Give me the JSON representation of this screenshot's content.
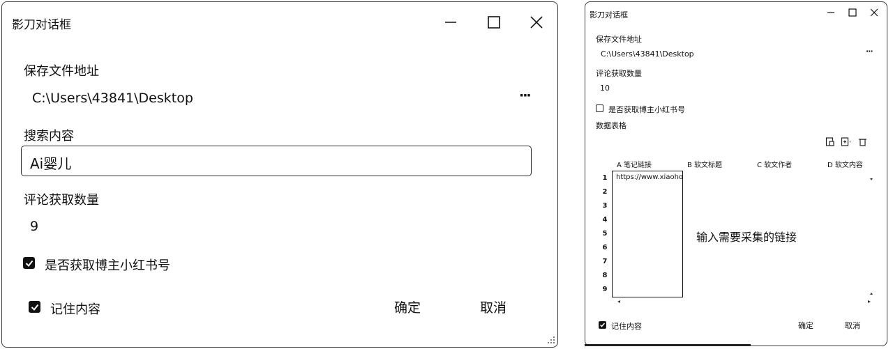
{
  "left_dialog": {
    "title": "影刀对话框",
    "save_path_label": "保存文件地址",
    "save_path_value": "C:\\Users\\43841\\Desktop",
    "browse_button": "···",
    "search_label": "搜索内容",
    "search_value": "Ai婴儿",
    "comment_count_label": "评论获取数量",
    "comment_count_value": "9",
    "get_account_checkbox": {
      "label": "是否获取博主小红书号",
      "checked": true
    },
    "remember_checkbox": {
      "label": "记住内容",
      "checked": true
    },
    "ok_button": "确定",
    "cancel_button": "取消"
  },
  "right_dialog": {
    "title": "影刀对话框",
    "save_path_label": "保存文件地址",
    "save_path_value": "C:\\Users\\43841\\Desktop",
    "browse_button": "···",
    "comment_count_label": "评论获取数量",
    "comment_count_value": "10",
    "get_account_checkbox": {
      "label": "是否获取博主小红书号",
      "checked": false
    },
    "table_label": "数据表格",
    "columns": [
      "A 笔记链接",
      "B 软文标题",
      "C 软文作者",
      "D 软文内容"
    ],
    "row_numbers": [
      "1",
      "2",
      "3",
      "4",
      "5",
      "6",
      "7",
      "8",
      "9"
    ],
    "first_cell": "https://www.xiaohongshu.com",
    "annotation": "输入需要采集的链接",
    "remember_checkbox": {
      "label": "记住内容",
      "checked": true
    },
    "ok_button": "确定",
    "cancel_button": "取消"
  },
  "icons": [
    "minimize-icon",
    "maximize-icon",
    "close-icon",
    "checkbox-checked-icon",
    "resize-grip-icon",
    "import-icon",
    "add-row-icon",
    "delete-icon"
  ]
}
